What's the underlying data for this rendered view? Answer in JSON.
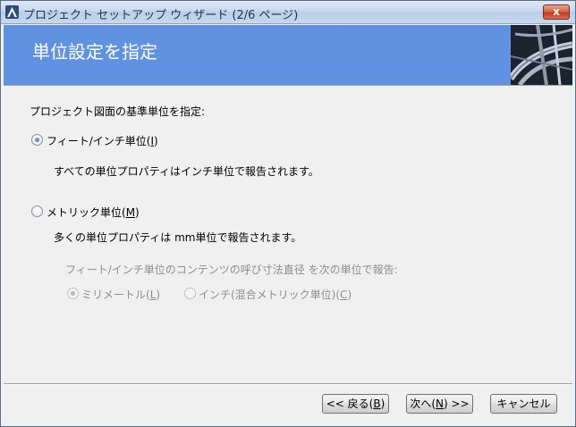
{
  "window": {
    "title": "プロジェクト セットアップ ウィザード (2/6 ページ)",
    "close_glyph": "x",
    "app_icon": "autodesk-a-icon"
  },
  "banner": {
    "title": "単位設定を指定",
    "background_color": "#6092e2",
    "image": "industrial-pipes-image"
  },
  "main": {
    "prompt": "プロジェクト図面の基準単位を指定:",
    "options": [
      {
        "label_pre": "フィート/インチ単位(",
        "accel": "I",
        "label_post": ")",
        "selected": true,
        "description": "すべての単位プロパティはインチ単位で報告されます。"
      },
      {
        "label_pre": "メトリック単位(",
        "accel": "M",
        "label_post": ")",
        "selected": false,
        "description": "多くの単位プロパティは mm単位で報告されます。"
      }
    ],
    "sub_prompt": "フィート/インチ単位のコンテンツの呼び寸法直径 を次の単位で報告:",
    "sub_options": [
      {
        "label_pre": "ミリメートル(",
        "accel": "L",
        "label_post": ")",
        "selected": true,
        "enabled": false
      },
      {
        "label_pre": "インチ(混合メトリック単位)(",
        "accel": "C",
        "label_post": ")",
        "selected": false,
        "enabled": false
      }
    ]
  },
  "footer": {
    "back": {
      "label_pre": "<< 戻る(",
      "accel": "B",
      "label_post": ")"
    },
    "next": {
      "label_pre": "次へ(",
      "accel": "N",
      "label_post": ") >>"
    },
    "cancel": {
      "label": "キャンセル"
    }
  }
}
